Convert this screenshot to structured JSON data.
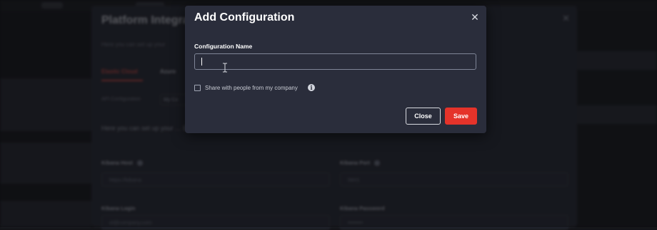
{
  "background": {
    "panel_title": "Platform Integrat",
    "panel_description": "Here you can set up your",
    "tabs": [
      "Elastic Cloud",
      "Azure"
    ],
    "config_label": "API Configuration",
    "config_select": "My Co",
    "intro_text": "Here you can set up your  …  Elastic Cluster using the Kibana interface",
    "fields": {
      "kibana_host_label": "Kibana Host",
      "kibana_host_placeholder": "https://kibana",
      "kibana_port_label": "Kibana Port",
      "kibana_port_placeholder": "5601",
      "kibana_login_label": "Kibana Login",
      "kibana_login_value": "ol@company.com",
      "kibana_password_label": "Kibana Password",
      "kibana_password_value": "••••••••"
    }
  },
  "modal": {
    "title": "Add Configuration",
    "close_glyph": "✕",
    "field_label": "Configuration Name",
    "input_value": "",
    "share_label": "Share with people from my company",
    "info_glyph": "i",
    "close_button": "Close",
    "save_button": "Save"
  },
  "colors": {
    "modal_bg": "#2a2d3b",
    "accent": "#e5332a",
    "input_border": "#7f8597"
  }
}
